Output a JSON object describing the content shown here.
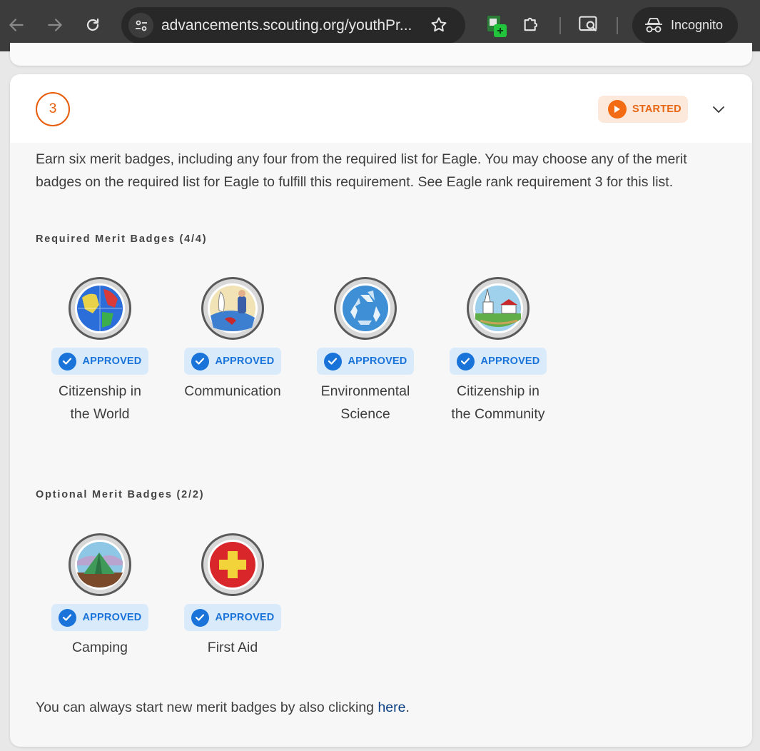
{
  "browser": {
    "url": "advancements.scouting.org/youthPr...",
    "incognito_label": "Incognito"
  },
  "requirement": {
    "number": "3",
    "status": "STARTED",
    "description": "Earn six merit badges, including any four from the required list for Eagle. You may choose any of the merit badges on the required list for Eagle to fulfill this requirement. See Eagle rank requirement 3 for this list."
  },
  "required_section": {
    "title": "Required Merit Badges (4/4)",
    "badges": [
      {
        "name": "Citizenship in the World",
        "status": "APPROVED",
        "icon": "globe-badge-icon"
      },
      {
        "name": "Communication",
        "status": "APPROVED",
        "icon": "communication-badge-icon"
      },
      {
        "name": "Environmental Science",
        "status": "APPROVED",
        "icon": "recycle-badge-icon"
      },
      {
        "name": "Citizenship in the Community",
        "status": "APPROVED",
        "icon": "town-badge-icon"
      }
    ]
  },
  "optional_section": {
    "title": "Optional Merit Badges (2/2)",
    "badges": [
      {
        "name": "Camping",
        "status": "APPROVED",
        "icon": "tent-badge-icon"
      },
      {
        "name": "First Aid",
        "status": "APPROVED",
        "icon": "first-aid-badge-icon"
      }
    ]
  },
  "footer": {
    "text": "You can always start new merit badges by also clicking ",
    "link_label": "here",
    "suffix": "."
  },
  "colors": {
    "accent_orange": "#e85d0c",
    "approved_blue": "#1a73d9",
    "link_blue": "#0a3f84"
  }
}
